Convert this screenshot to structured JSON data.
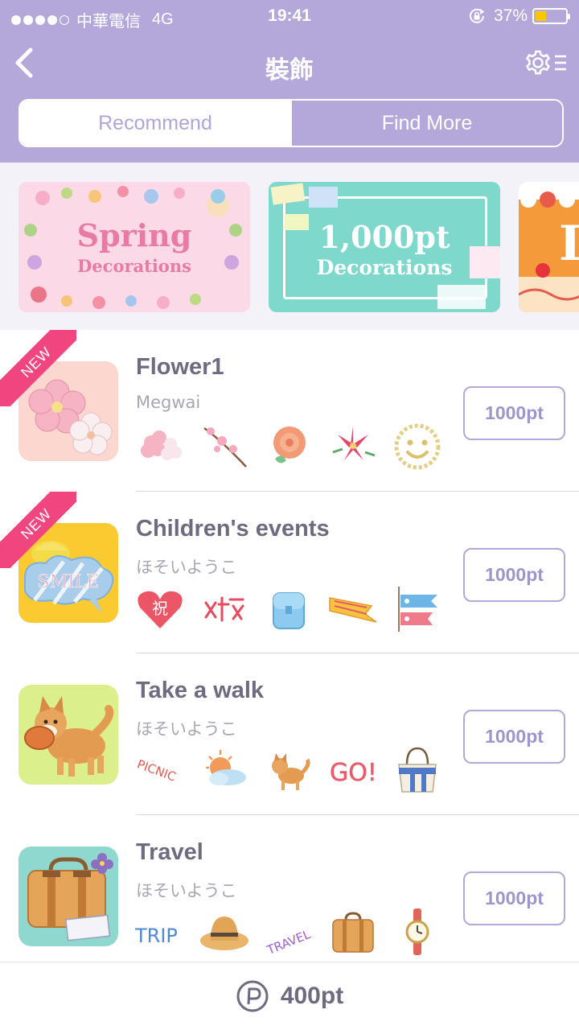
{
  "status_bar": {
    "carrier": "中華電信",
    "network": "4G",
    "time": "19:41",
    "battery_pct": "37%",
    "battery_level": 0.37,
    "battery_color": "#f6c800"
  },
  "nav": {
    "title": "裝飾",
    "back_icon": "chevron-left-icon",
    "settings_icon": "gear-list-icon"
  },
  "tabs": [
    {
      "label": "Recommend",
      "active": true
    },
    {
      "label": "Find More",
      "active": false
    }
  ],
  "banners": [
    {
      "line1": "Spring",
      "line2": "Decorations"
    },
    {
      "line1": "1,000pt",
      "line2": "Decorations"
    },
    {
      "line1": "D"
    }
  ],
  "items": [
    {
      "title": "Flower1",
      "author": "Megwai",
      "price": "1000pt",
      "badge": "NEW"
    },
    {
      "title": "Children's events",
      "author": "ほそいようこ",
      "price": "1000pt",
      "badge": "NEW"
    },
    {
      "title": "Take a walk",
      "author": "ほそいようこ",
      "price": "1000pt"
    },
    {
      "title": "Travel",
      "author": "ほそいようこ",
      "price": "1000pt"
    }
  ],
  "footer": {
    "balance": "400pt",
    "icon": "points-p-icon"
  },
  "colors": {
    "header": "#b4a7da",
    "accent_text": "#9f95cb",
    "new_badge": "#f0457e",
    "title_text": "#6e6a80"
  }
}
